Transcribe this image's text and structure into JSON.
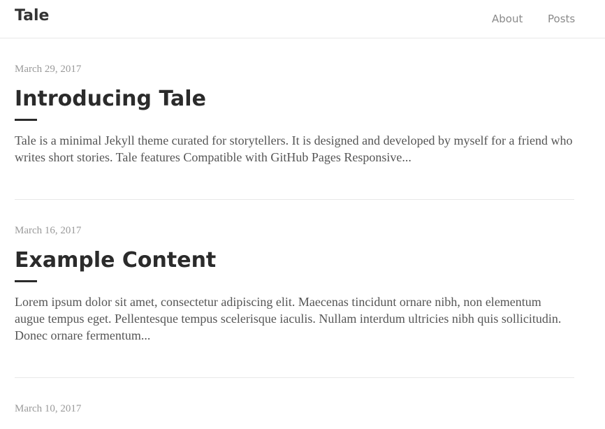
{
  "header": {
    "site_title": "Tale",
    "nav": [
      {
        "label": "About"
      },
      {
        "label": "Posts"
      }
    ]
  },
  "posts": [
    {
      "date": "March 29, 2017",
      "title": "Introducing Tale",
      "excerpt": "Tale is a minimal Jekyll theme curated for storytellers. It is designed and developed by myself for a friend who writes short stories. Tale features Compatible with GitHub Pages Responsive..."
    },
    {
      "date": "March 16, 2017",
      "title": "Example Content",
      "excerpt": "Lorem ipsum dolor sit amet, consectetur adipiscing elit. Maecenas tincidunt ornare nibh, non elementum augue tempus eget. Pellentesque tempus scelerisque iaculis. Nullam interdum ultricies nibh quis sollicitudin. Donec ornare fermentum..."
    },
    {
      "date": "March 10, 2017"
    }
  ]
}
